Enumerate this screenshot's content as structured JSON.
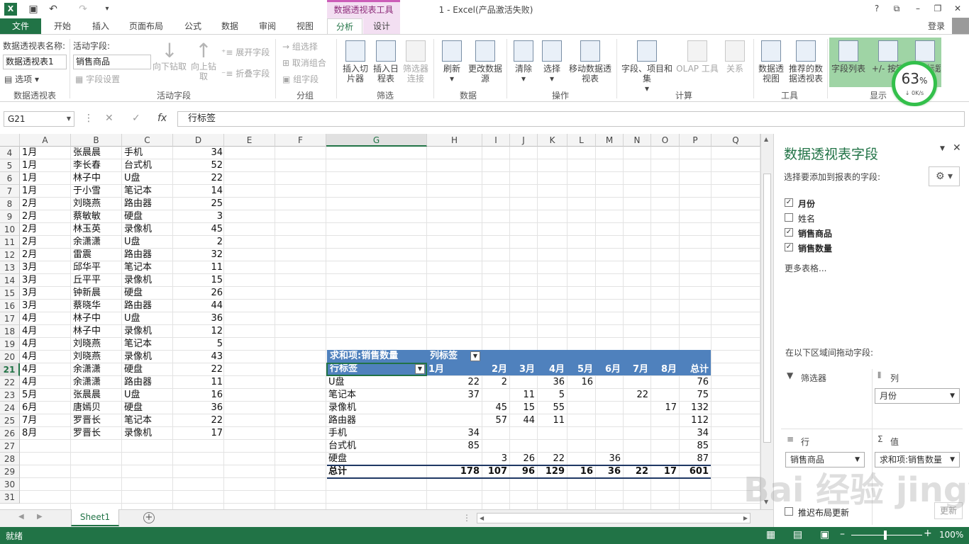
{
  "window": {
    "title": "1 - Excel(产品激活失败)",
    "context_tab_group": "数据透视表工具",
    "help": "?",
    "login": "登录"
  },
  "tabs": [
    {
      "label": "文件"
    },
    {
      "label": "开始"
    },
    {
      "label": "插入"
    },
    {
      "label": "页面布局"
    },
    {
      "label": "公式"
    },
    {
      "label": "数据"
    },
    {
      "label": "审阅"
    },
    {
      "label": "视图"
    },
    {
      "label": "分析"
    },
    {
      "label": "设计"
    }
  ],
  "ribbon": {
    "pivot_name_label": "数据透视表名称:",
    "pivot_name_value": "数据透视表1",
    "options_label": "选项",
    "active_field_label": "活动字段:",
    "active_field_value": "销售商品",
    "field_settings": "字段设置",
    "drill_down": "向下钻取",
    "drill_up": "向上钻取",
    "expand_field": "展开字段",
    "collapse_field": "折叠字段",
    "group_selection": "组选择",
    "ungroup": "取消组合",
    "group_field": "组字段",
    "insert_slicer": "插入切片器",
    "insert_timeline": "插入日程表",
    "filter_connections": "筛选器连接",
    "refresh": "刷新",
    "change_source": "更改数据源",
    "clear": "清除",
    "select": "选择",
    "move_pivot": "移动数据透视表",
    "fields_items_sets": "字段、项目和集",
    "olap_tools": "OLAP 工具",
    "relationships": "关系",
    "pivot_chart": "数据透视图",
    "recommended_pivot": "推荐的数据透视表",
    "field_list": "字段列表",
    "buttons": "+/- 按钮",
    "field_headers": "字段标题",
    "groups": {
      "pivottable": "数据透视表",
      "active_field": "活动字段",
      "group": "分组",
      "filter": "筛选",
      "data": "数据",
      "actions": "操作",
      "calculations": "计算",
      "tools": "工具",
      "show": "显示"
    }
  },
  "speed_widget": {
    "percent": "63",
    "percent_sign": "%",
    "rate": "0K/s"
  },
  "formula_bar": {
    "name_box": "G21",
    "content": "行标签"
  },
  "columns": [
    "A",
    "B",
    "C",
    "D",
    "E",
    "F",
    "G",
    "H",
    "I",
    "J",
    "K",
    "L",
    "M",
    "N",
    "O",
    "P",
    "Q"
  ],
  "rows": [
    "4",
    "5",
    "6",
    "7",
    "8",
    "9",
    "10",
    "11",
    "12",
    "13",
    "14",
    "15",
    "16",
    "17",
    "18",
    "19",
    "20",
    "21",
    "22",
    "23",
    "24",
    "25",
    "26",
    "27",
    "28",
    "29",
    "30",
    "31"
  ],
  "source_data": [
    [
      "1月",
      "张晨晨",
      "手机",
      "34"
    ],
    [
      "1月",
      "李长春",
      "台式机",
      "52"
    ],
    [
      "1月",
      "林子中",
      "U盘",
      "22"
    ],
    [
      "1月",
      "于小雪",
      "笔记本",
      "14"
    ],
    [
      "2月",
      "刘晓燕",
      "路由器",
      "25"
    ],
    [
      "2月",
      "蔡敏敏",
      "硬盘",
      "3"
    ],
    [
      "2月",
      "林玉英",
      "录像机",
      "45"
    ],
    [
      "2月",
      "余潇潇",
      "U盘",
      "2"
    ],
    [
      "2月",
      "雷震",
      "路由器",
      "32"
    ],
    [
      "3月",
      "邱华平",
      "笔记本",
      "11"
    ],
    [
      "3月",
      "丘平平",
      "录像机",
      "15"
    ],
    [
      "3月",
      "钟新晨",
      "硬盘",
      "26"
    ],
    [
      "3月",
      "蔡晓华",
      "路由器",
      "44"
    ],
    [
      "4月",
      "林子中",
      "U盘",
      "36"
    ],
    [
      "4月",
      "林子中",
      "录像机",
      "12"
    ],
    [
      "4月",
      "刘晓燕",
      "笔记本",
      "5"
    ],
    [
      "4月",
      "刘晓燕",
      "录像机",
      "43"
    ],
    [
      "4月",
      "余潇潇",
      "硬盘",
      "22"
    ],
    [
      "4月",
      "余潇潇",
      "路由器",
      "11"
    ],
    [
      "5月",
      "张晨晨",
      "U盘",
      "16"
    ],
    [
      "6月",
      "唐嫣贝",
      "硬盘",
      "36"
    ],
    [
      "7月",
      "罗晋长",
      "笔记本",
      "22"
    ],
    [
      "8月",
      "罗晋长",
      "录像机",
      "17"
    ]
  ],
  "pivot": {
    "value_label": "求和项:销售数量",
    "col_label": "列标签",
    "row_label": "行标签",
    "months": [
      "1月",
      "2月",
      "3月",
      "4月",
      "5月",
      "6月",
      "7月",
      "8月",
      "总计"
    ],
    "rows": [
      {
        "name": "U盘",
        "values": [
          "22",
          "2",
          "",
          "36",
          "16",
          "",
          "",
          "",
          "76"
        ]
      },
      {
        "name": "笔记本",
        "values": [
          "37",
          "",
          "11",
          "5",
          "",
          "",
          "22",
          "",
          "75"
        ]
      },
      {
        "name": "录像机",
        "values": [
          "",
          "45",
          "15",
          "55",
          "",
          "",
          "",
          "17",
          "132"
        ]
      },
      {
        "name": "路由器",
        "values": [
          "",
          "57",
          "44",
          "11",
          "",
          "",
          "",
          "",
          "112"
        ]
      },
      {
        "name": "手机",
        "values": [
          "34",
          "",
          "",
          "",
          "",
          "",
          "",
          "",
          "34"
        ]
      },
      {
        "name": "台式机",
        "values": [
          "85",
          "",
          "",
          "",
          "",
          "",
          "",
          "",
          "85"
        ]
      },
      {
        "name": "硬盘",
        "values": [
          "",
          "3",
          "26",
          "22",
          "",
          "36",
          "",
          "",
          "87"
        ]
      }
    ],
    "total": {
      "name": "总计",
      "values": [
        "178",
        "107",
        "96",
        "129",
        "16",
        "36",
        "22",
        "17",
        "601"
      ]
    }
  },
  "sheet_tab": "Sheet1",
  "status": {
    "ready": "就绪",
    "zoom": "100%"
  },
  "pane": {
    "title": "数据透视表字段",
    "subtitle": "选择要添加到报表的字段:",
    "fields": [
      {
        "label": "月份",
        "checked": "✓"
      },
      {
        "label": "姓名",
        "checked": ""
      },
      {
        "label": "销售商品",
        "checked": "✓"
      },
      {
        "label": "销售数量",
        "checked": "✓"
      }
    ],
    "more_tables": "更多表格...",
    "drag_hint": "在以下区域间拖动字段:",
    "filters_label": "筛选器",
    "columns_label": "列",
    "rows_label": "行",
    "values_label": "值",
    "col_field": "月份",
    "row_field": "销售商品",
    "value_field": "求和项:销售数量",
    "defer_label": "推迟布局更新",
    "update_button": "更新"
  },
  "watermark": "Bai 经验 jingyan.baidu.com"
}
